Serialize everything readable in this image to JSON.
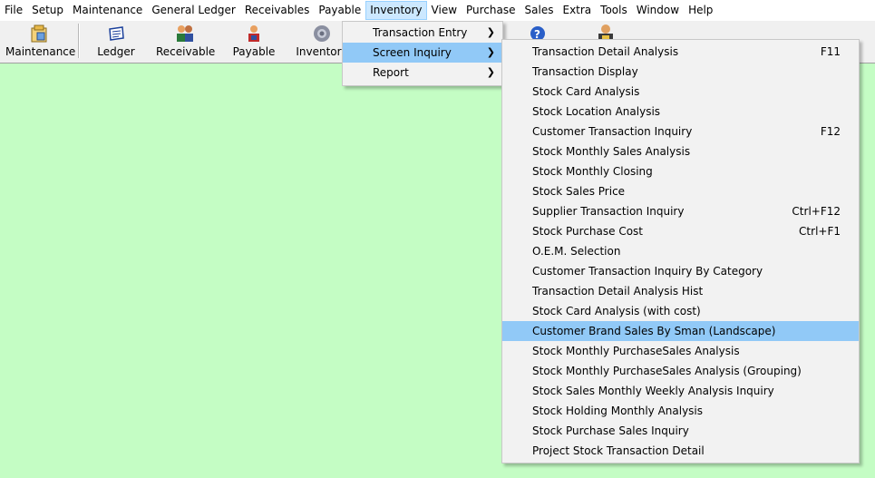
{
  "menubar": {
    "items": [
      "File",
      "Setup",
      "Maintenance",
      "General Ledger",
      "Receivables",
      "Payable",
      "Inventory",
      "View",
      "Purchase",
      "Sales",
      "Extra",
      "Tools",
      "Window",
      "Help"
    ],
    "active": "Inventory"
  },
  "toolbar": {
    "buttons": [
      {
        "label": "Maintenance",
        "icon": "maintenance-icon"
      },
      {
        "label": "Ledger",
        "icon": "ledger-icon"
      },
      {
        "label": "Receivable",
        "icon": "receivable-icon"
      },
      {
        "label": "Payable",
        "icon": "payable-icon"
      },
      {
        "label": "Inventory",
        "icon": "inventory-gear-icon"
      }
    ]
  },
  "inventory_menu": {
    "items": [
      {
        "label": "Transaction Entry",
        "submenu": true
      },
      {
        "label": "Screen Inquiry",
        "submenu": true,
        "highlighted": true
      },
      {
        "label": "Report",
        "submenu": true
      }
    ]
  },
  "screen_inquiry_menu": {
    "items": [
      {
        "label": "Transaction Detail Analysis",
        "shortcut": "F11"
      },
      {
        "label": "Transaction Display",
        "shortcut": ""
      },
      {
        "label": "Stock Card Analysis",
        "shortcut": ""
      },
      {
        "label": "Stock Location Analysis",
        "shortcut": ""
      },
      {
        "label": "Customer Transaction Inquiry",
        "shortcut": "F12"
      },
      {
        "label": "Stock Monthly Sales Analysis",
        "shortcut": ""
      },
      {
        "label": "Stock Monthly Closing",
        "shortcut": ""
      },
      {
        "label": "Stock Sales Price",
        "shortcut": ""
      },
      {
        "label": "Supplier Transaction Inquiry",
        "shortcut": "Ctrl+F12"
      },
      {
        "label": "Stock Purchase Cost",
        "shortcut": "Ctrl+F1"
      },
      {
        "label": "O.E.M. Selection",
        "shortcut": ""
      },
      {
        "label": "Customer Transaction Inquiry By Category",
        "shortcut": ""
      },
      {
        "label": "Transaction Detail Analysis Hist",
        "shortcut": ""
      },
      {
        "label": "Stock Card Analysis (with cost)",
        "shortcut": ""
      },
      {
        "label": "Customer Brand Sales By Sman (Landscape)",
        "shortcut": "",
        "highlighted": true
      },
      {
        "label": "Stock Monthly PurchaseSales Analysis",
        "shortcut": ""
      },
      {
        "label": "Stock Monthly PurchaseSales Analysis (Grouping)",
        "shortcut": ""
      },
      {
        "label": "Stock Sales Monthly Weekly Analysis Inquiry",
        "shortcut": ""
      },
      {
        "label": "Stock Holding Monthly Analysis",
        "shortcut": ""
      },
      {
        "label": "Stock Purchase Sales Inquiry",
        "shortcut": ""
      },
      {
        "label": "Project Stock Transaction Detail",
        "shortcut": ""
      }
    ]
  },
  "colors": {
    "workspace": "#c4fdc4",
    "menu_highlight": "#91c9f7",
    "menubar_active": "#cce8ff"
  }
}
